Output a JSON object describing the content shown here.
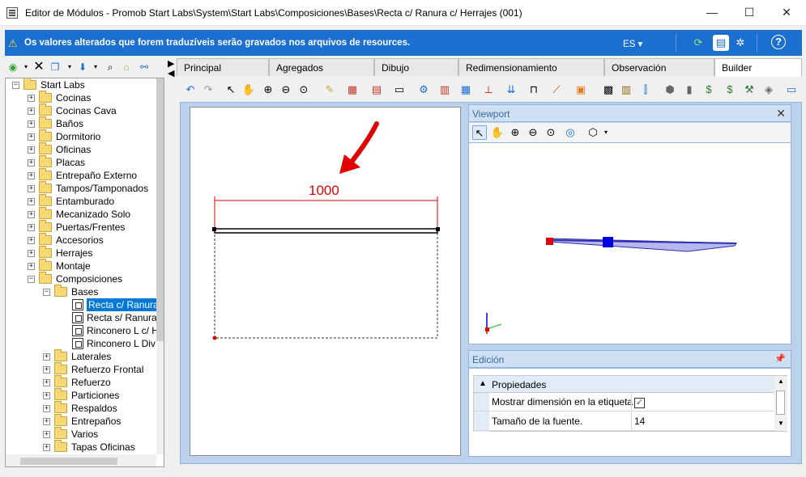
{
  "window": {
    "title": "Editor de Módulos - Promob Start Labs\\System\\Start Labs\\Composiciones\\Bases\\Recta c/ Ranura c/ Herrajes (001)",
    "minimize": "—",
    "maximize": "☐",
    "close": "✕"
  },
  "infobar": {
    "message": "Os valores alterados que forem traduzíveis serão gravados nos arquivos de resources.",
    "language": "ES ▾",
    "colors": {
      "background": "#1b6fcf"
    }
  },
  "tree": {
    "root": "Start Labs",
    "items": [
      "Cocinas",
      "Cocinas Cava",
      "Baños",
      "Dormitorio",
      "Oficinas",
      "Placas",
      "Entrepaño Externo",
      "Tampos/Tamponados",
      "Entamburado",
      "Mecanizado Solo",
      "Puertas/Frentes",
      "Accesorios",
      "Herrajes",
      "Montaje"
    ],
    "composiciones": "Composiciones",
    "bases": "Bases",
    "modules": [
      "Recta c/ Ranura",
      "Recta s/ Ranura",
      "Rinconero L c/ H",
      "Rinconero L Div"
    ],
    "comp_items": [
      "Laterales",
      "Refuerzo Frontal",
      "Refuerzo",
      "Particiones",
      "Respaldos",
      "Entrepaños",
      "Varios",
      "Tapas Oficinas"
    ]
  },
  "tabs": [
    "Principal",
    "Agregados",
    "Dibujo",
    "Redimensionamiento",
    "Observación",
    "Builder"
  ],
  "drawing": {
    "dimension": "1000"
  },
  "viewport": {
    "title": "Viewport",
    "close": "✕"
  },
  "edicion": {
    "title": "Edición",
    "category": "Propiedades",
    "rows": [
      {
        "name": "Mostrar dimensión en la etiqueta",
        "value": "✓"
      },
      {
        "name": "Tamaño de la fuente.",
        "value": "14"
      }
    ]
  },
  "icons": {
    "refresh": "refresh-icon",
    "help": "help-icon",
    "settings": "gear-icon"
  }
}
